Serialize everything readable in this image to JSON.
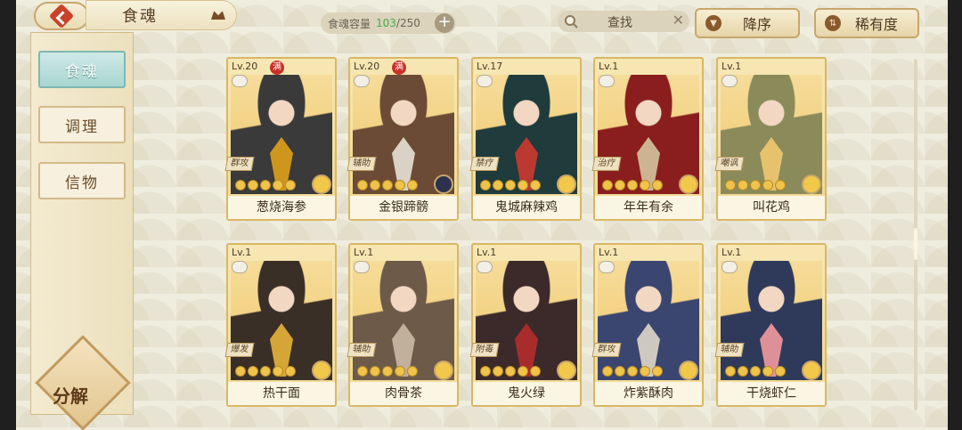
{
  "header": {
    "title": "食魂",
    "capacity_label": "食魂容量",
    "capacity_current": "103",
    "capacity_max": "/250",
    "capacity_add": "+",
    "search_placeholder": "查找",
    "search_clear": "✕",
    "sort_order_label": "降序",
    "sort_rarity_label": "稀有度"
  },
  "sidebar": {
    "tabs": [
      {
        "label": "食魂",
        "active": true
      },
      {
        "label": "调理",
        "active": false
      },
      {
        "label": "信物",
        "active": false
      }
    ],
    "decompose_label": "分解"
  },
  "cards": [
    {
      "level": "Lv.20",
      "max": "满",
      "role": "群攻",
      "name": "葱烧海参",
      "stars": 5,
      "gem": "gold",
      "bg": "#3b3a3a",
      "accent": "#e0a11b"
    },
    {
      "level": "Lv.20",
      "max": "满",
      "role": "辅助",
      "name": "金银蹄髈",
      "stars": 5,
      "gem": "dark",
      "bg": "#6b4b35",
      "accent": "#e7e1d4"
    },
    {
      "level": "Lv.17",
      "max": "",
      "role": "禁疗",
      "name": "鬼城麻辣鸡",
      "stars": 5,
      "gem": "gold",
      "bg": "#1f3b3c",
      "accent": "#cc3a2f"
    },
    {
      "level": "Lv.1",
      "max": "",
      "role": "治疗",
      "name": "年年有余",
      "stars": 5,
      "gem": "gold",
      "bg": "#8a1e1e",
      "accent": "#d5c3a0"
    },
    {
      "level": "Lv.1",
      "max": "",
      "role": "嘲讽",
      "name": "叫花鸡",
      "stars": 5,
      "gem": "gold",
      "bg": "#8a8a5a",
      "accent": "#f0c870"
    },
    {
      "level": "Lv.1",
      "max": "",
      "role": "爆发",
      "name": "热干面",
      "stars": 5,
      "gem": "gold",
      "bg": "#3a2f26",
      "accent": "#e7b43a"
    },
    {
      "level": "Lv.1",
      "max": "",
      "role": "辅助",
      "name": "肉骨茶",
      "stars": 5,
      "gem": "gold",
      "bg": "#6d5a49",
      "accent": "#c9b9a5"
    },
    {
      "level": "Lv.1",
      "max": "",
      "role": "附毒",
      "name": "鬼火绿",
      "stars": 5,
      "gem": "gold",
      "bg": "#3c2a2a",
      "accent": "#b52c2c"
    },
    {
      "level": "Lv.1",
      "max": "",
      "role": "群攻",
      "name": "炸紫酥肉",
      "stars": 5,
      "gem": "gold",
      "bg": "#3a4570",
      "accent": "#e0d6c9"
    },
    {
      "level": "Lv.1",
      "max": "",
      "role": "辅助",
      "name": "干烧虾仁",
      "stars": 5,
      "gem": "gold",
      "bg": "#2f3a5a",
      "accent": "#f29aa0"
    }
  ]
}
